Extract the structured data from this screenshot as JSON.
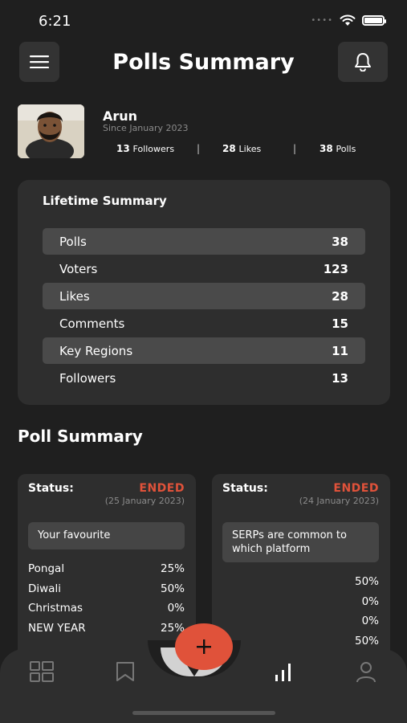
{
  "status_bar": {
    "time": "6:21"
  },
  "header": {
    "title": "Polls Summary"
  },
  "profile": {
    "name": "Arun",
    "since": "Since January 2023",
    "stats": [
      {
        "value": "13",
        "label": "Followers"
      },
      {
        "value": "28",
        "label": "Likes"
      },
      {
        "value": "38",
        "label": "Polls"
      }
    ]
  },
  "lifetime": {
    "title": "Lifetime Summary",
    "rows": [
      {
        "label": "Polls",
        "value": "38"
      },
      {
        "label": "Voters",
        "value": "123"
      },
      {
        "label": "Likes",
        "value": "28"
      },
      {
        "label": "Comments",
        "value": "15"
      },
      {
        "label": "Key Regions",
        "value": "11"
      },
      {
        "label": "Followers",
        "value": "13"
      }
    ]
  },
  "poll_summary": {
    "title": "Poll Summary",
    "cards": [
      {
        "status_label": "Status:",
        "status": "ENDED",
        "date": "(25 January 2023)",
        "question": "Your favourite",
        "options": [
          {
            "label": "Pongal",
            "percent": "25%"
          },
          {
            "label": "Diwali",
            "percent": "50%"
          },
          {
            "label": "Christmas",
            "percent": "0%"
          },
          {
            "label": "NEW YEAR",
            "percent": "25%"
          }
        ]
      },
      {
        "status_label": "Status:",
        "status": "ENDED",
        "date": "(24 January 2023)",
        "question": "SERPs are common to which platform",
        "options": [
          {
            "label": "",
            "percent": "50%"
          },
          {
            "label": "",
            "percent": "0%"
          },
          {
            "label": "",
            "percent": "0%"
          },
          {
            "label": "",
            "percent": "50%"
          }
        ]
      }
    ]
  },
  "tab_bar": {
    "items": [
      "dashboard-icon",
      "bookmark-icon",
      "add-icon",
      "chart-icon",
      "profile-icon"
    ],
    "fab_label": "+"
  },
  "colors": {
    "background": "#1f1f1f",
    "card": "#2e2e2e",
    "accent": "#e0523a",
    "highlight_row": "#4a4a4a"
  }
}
